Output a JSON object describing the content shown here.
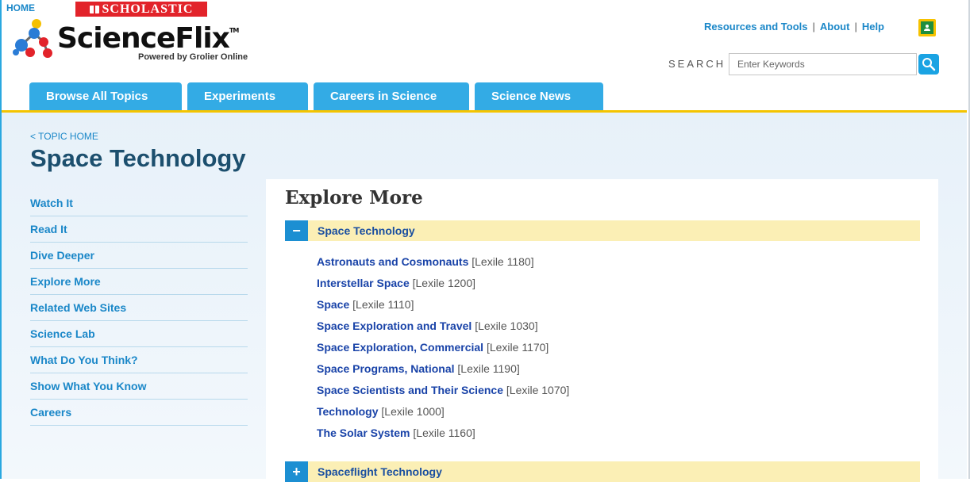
{
  "header": {
    "home_label": "HOME",
    "scholastic_label": "SCHOLASTIC",
    "brand_name": "ScienceFlix",
    "brand_tm": "TM",
    "brand_sub": "Powered by Grolier Online",
    "util_links": [
      "Resources and Tools",
      "About",
      "Help"
    ],
    "search_label": "SEARCH",
    "search_placeholder": "Enter Keywords"
  },
  "nav": {
    "tabs": [
      "Browse All Topics",
      "Experiments",
      "Careers in Science",
      "Science News"
    ]
  },
  "page": {
    "back_link": "< TOPIC HOME",
    "title": "Space Technology"
  },
  "sidebar": {
    "items": [
      "Watch It",
      "Read It",
      "Dive Deeper",
      "Explore More",
      "Related Web Sites",
      "Science Lab",
      "What Do You Think?",
      "Show What You Know",
      "Careers"
    ]
  },
  "explore": {
    "title": "Explore More",
    "sections": [
      {
        "label": "Space Technology",
        "toggle": "−",
        "items": [
          {
            "title": "Astronauts and Cosmonauts",
            "lexile": "[Lexile 1180]"
          },
          {
            "title": "Interstellar Space",
            "lexile": "[Lexile 1200]"
          },
          {
            "title": "Space",
            "lexile": "[Lexile 1110]"
          },
          {
            "title": "Space Exploration and Travel",
            "lexile": "[Lexile 1030]"
          },
          {
            "title": "Space Exploration, Commercial",
            "lexile": "[Lexile 1170]"
          },
          {
            "title": "Space Programs, National",
            "lexile": "[Lexile 1190]"
          },
          {
            "title": "Space Scientists and Their Science",
            "lexile": "[Lexile 1070]"
          },
          {
            "title": "Technology",
            "lexile": "[Lexile 1000]"
          },
          {
            "title": "The Solar System",
            "lexile": "[Lexile 1160]"
          }
        ]
      },
      {
        "label": "Spaceflight Technology",
        "toggle": "+"
      }
    ]
  },
  "colors": {
    "accent": "#33abe5",
    "gold": "#f4c400",
    "title": "#1c4f6e",
    "link": "#1943a8"
  }
}
